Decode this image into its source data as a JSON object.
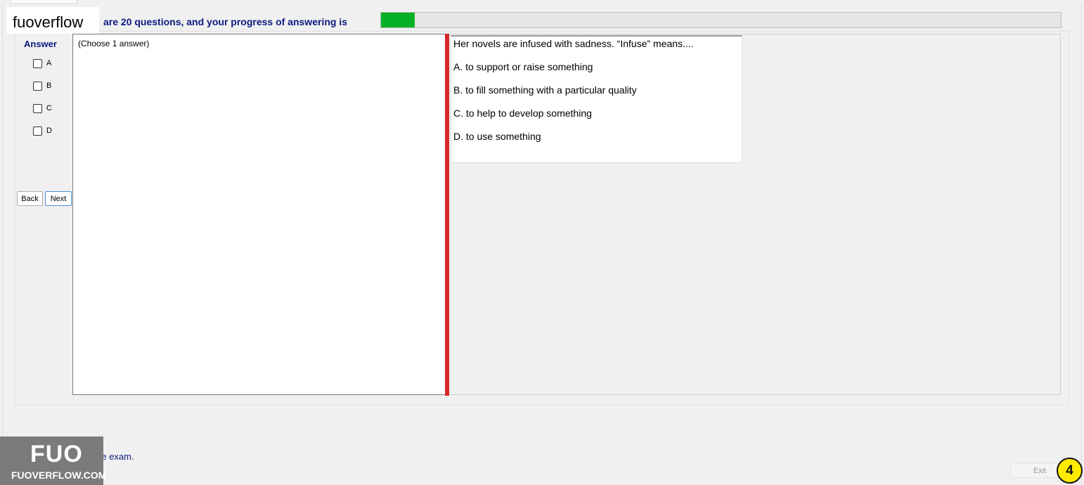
{
  "header": {
    "text": "are 20 questions, and your progress of answering is",
    "progress_percent": 5
  },
  "watermark": {
    "logo_text": "fuoverflow",
    "badge_big": "FUO",
    "badge_small": "FUOVERFLOW.COM"
  },
  "answer": {
    "title": "Answer",
    "options": [
      "A",
      "B",
      "C",
      "D"
    ],
    "choose_text": "(Choose 1 answer)"
  },
  "nav": {
    "back_label": "Back",
    "next_label": "Next"
  },
  "question": {
    "stem": "Her novels are infused with sadness. “Infuse” means....",
    "choices": [
      "A.  to support or raise something",
      "B.  to fill something with a particular quality",
      "C.  to help to develop something",
      "D.  to use something"
    ]
  },
  "footer": {
    "finish_text": "want to finish the exam.",
    "exit_label": "Exit",
    "page_number": "4"
  },
  "colors": {
    "accent_text": "#0b1a80",
    "progress_fill": "#06b025",
    "splitter": "#d62828",
    "badge": "#ffea00"
  }
}
